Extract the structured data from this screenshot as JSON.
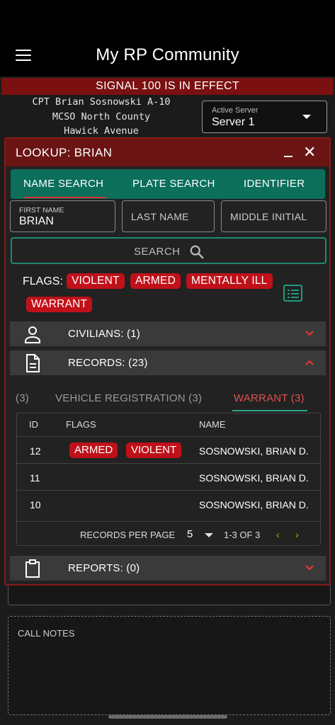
{
  "app": {
    "title": "My RP Community"
  },
  "banner": {
    "text": "SIGNAL 100 IS IN EFFECT"
  },
  "unit": {
    "line1": "CPT Brian Sosnowski A-10",
    "line2": "MCSO North County",
    "line3": "Hawick Avenue"
  },
  "server": {
    "label": "Active Server",
    "value": "Server 1"
  },
  "lookup": {
    "title": "LOOKUP: BRIAN",
    "close_glyph": "✕",
    "tabs": [
      "NAME SEARCH",
      "PLATE SEARCH",
      "IDENTIFIER"
    ],
    "first_name": {
      "label": "FIRST NAME",
      "value": "BRIAN"
    },
    "last_name": {
      "placeholder": "LAST NAME"
    },
    "middle_initial": {
      "placeholder": "MIDDLE INITIAL"
    },
    "search_label": "SEARCH",
    "flags_label": "FLAGS:",
    "flags": [
      "VIOLENT",
      "ARMED",
      "MENTALLY ILL",
      "WARRANT"
    ],
    "sections": {
      "civilians": "CIVILIANS: (1)",
      "records": "RECORDS: (23)",
      "reports": "REPORTS: (0)"
    },
    "record_tabs": [
      "(3)",
      "VEHICLE REGISTRATION (3)",
      "WARRANT (3)"
    ],
    "table": {
      "headers": [
        "ID",
        "FLAGS",
        "NAME"
      ],
      "rows": [
        {
          "id": "12",
          "flags": [
            "ARMED",
            "VIOLENT"
          ],
          "name": "SOSNOWSKI, BRIAN D."
        },
        {
          "id": "11",
          "flags": [],
          "name": "SOSNOWSKI, BRIAN D."
        },
        {
          "id": "10",
          "flags": [],
          "name": "SOSNOWSKI, BRIAN D."
        }
      ],
      "records_per_page_label": "RECORDS PER PAGE",
      "records_per_page": "5",
      "range": "1-3 OF 3",
      "prev_glyph": "‹",
      "next_glyph": "›"
    }
  },
  "call_notes": {
    "label": "CALL NOTES"
  },
  "colors": {
    "accent_teal": "#0b6f5a",
    "flag_red": "#c0111a",
    "header_red": "#6a1414",
    "pager_gold": "#d9a400"
  }
}
